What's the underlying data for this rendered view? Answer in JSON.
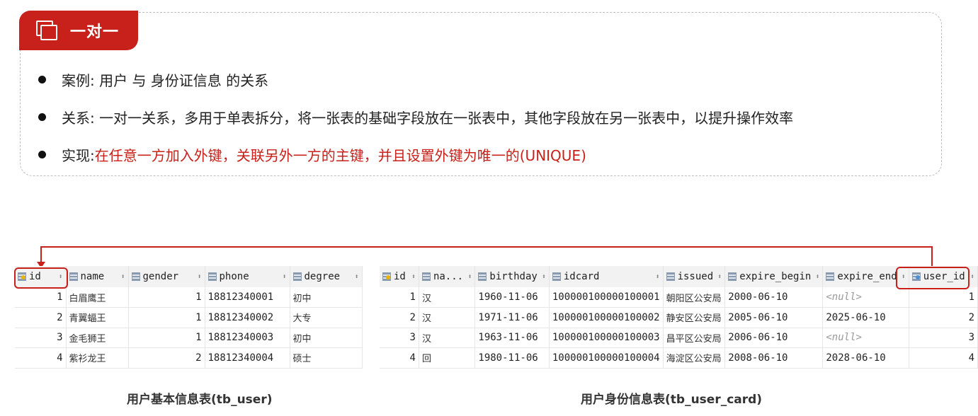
{
  "header": {
    "title": "一对一"
  },
  "bullets": {
    "b1": "案例: 用户 与 身份证信息 的关系",
    "b2": "关系: 一对一关系，多用于单表拆分，将一张表的基础字段放在一张表中，其他字段放在另一张表中，以提升操作效率",
    "b3_prefix": "实现: ",
    "b3_red": "在任意一方加入外键，关联另外一方的主键，并且设置外键为唯一的(UNIQUE)"
  },
  "tb_user": {
    "caption": "用户基本信息表(tb_user)",
    "columns": [
      "id",
      "name",
      "gender",
      "phone",
      "degree"
    ],
    "rows": [
      [
        "1",
        "白眉鹰王",
        "1",
        "18812340001",
        "初中"
      ],
      [
        "2",
        "青翼蝠王",
        "1",
        "18812340002",
        "大专"
      ],
      [
        "3",
        "金毛狮王",
        "1",
        "18812340003",
        "初中"
      ],
      [
        "4",
        "紫衫龙王",
        "2",
        "18812340004",
        "硕士"
      ]
    ]
  },
  "tb_user_card": {
    "caption": "用户身份信息表(tb_user_card)",
    "columns": [
      "id",
      "na...",
      "birthday",
      "idcard",
      "issued",
      "expire_begin",
      "expire_end",
      "user_id"
    ],
    "rows": [
      [
        "1",
        "汉",
        "1960-11-06",
        "100000100000100001",
        "朝阳区公安局",
        "2000-06-10",
        "<null>",
        "1"
      ],
      [
        "2",
        "汉",
        "1971-11-06",
        "100000100000100002",
        "静安区公安局",
        "2005-06-10",
        "2025-06-10",
        "2"
      ],
      [
        "3",
        "汉",
        "1963-11-06",
        "100000100000100003",
        "昌平区公安局",
        "2006-06-10",
        "<null>",
        "3"
      ],
      [
        "4",
        "回",
        "1980-11-06",
        "100000100000100004",
        "海淀区公安局",
        "2008-06-10",
        "2028-06-10",
        "4"
      ]
    ]
  },
  "colors": {
    "accent": "#c8201a",
    "null_text": "#9a9a9a"
  }
}
